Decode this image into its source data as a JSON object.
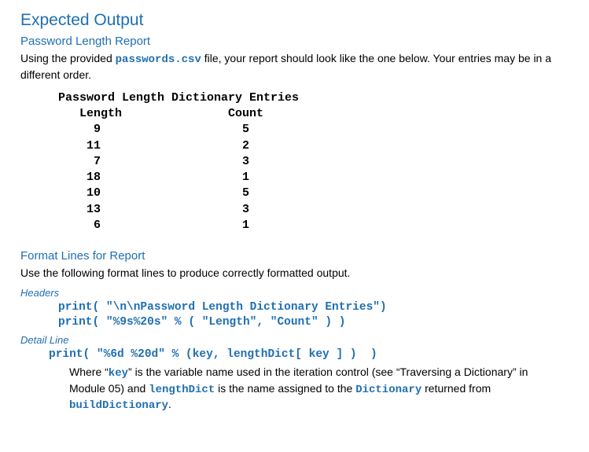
{
  "title": "Expected Output",
  "section1": {
    "heading": "Password Length Report",
    "intro_pre": "Using the provided ",
    "intro_code": "passwords.csv",
    "intro_post": " file, your report should look like the one below. Your entries may be in a different order."
  },
  "report": {
    "title": "Password Length Dictionary Entries",
    "col1": "Length",
    "col2": "Count",
    "rows": [
      {
        "length": 9,
        "count": 5
      },
      {
        "length": 11,
        "count": 2
      },
      {
        "length": 7,
        "count": 3
      },
      {
        "length": 18,
        "count": 1
      },
      {
        "length": 10,
        "count": 5
      },
      {
        "length": 13,
        "count": 3
      },
      {
        "length": 6,
        "count": 1
      }
    ]
  },
  "section2": {
    "heading": "Format Lines for Report",
    "intro": "Use the following format lines to produce correctly formatted output.",
    "headers_label": "Headers",
    "header_line1": "print( \"\\n\\nPassword Length Dictionary Entries\")",
    "header_line2": "print( \"%9s%20s\" % ( \"Length\", \"Count\" ) )",
    "detail_label": "Detail Line",
    "detail_line": "print( \"%6d %20d\" % (key, lengthDict[ key ] )  )",
    "explain_pre": "Where “",
    "explain_key": "key",
    "explain_mid1": "” is the variable name used in the iteration control (see “Traversing a Dictionary” in Module 05) and ",
    "explain_lengthDict": "lengthDict",
    "explain_mid2": " is the name assigned to the ",
    "explain_Dictionary": "Dictionary",
    "explain_mid3": " returned from ",
    "explain_buildDictionary": "buildDictionary",
    "explain_end": "."
  }
}
